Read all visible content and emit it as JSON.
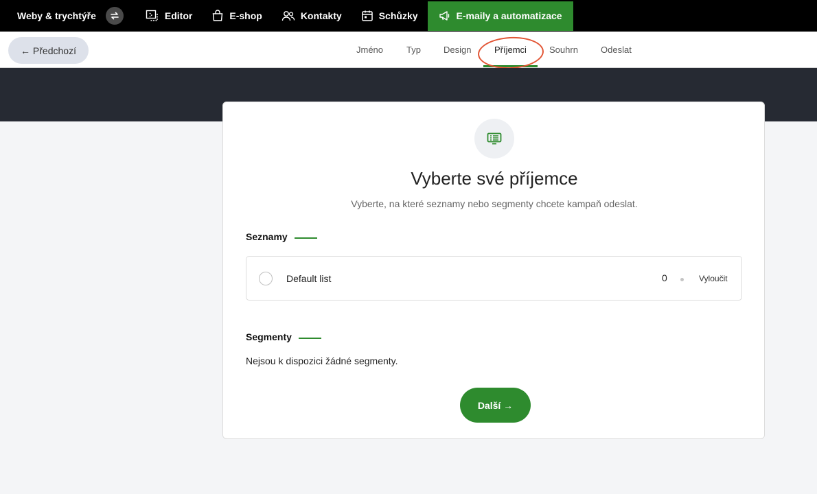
{
  "topnav": {
    "brand": "Weby & trychtýře",
    "items": [
      {
        "label": "Editor",
        "icon": "editor-icon"
      },
      {
        "label": "E-shop",
        "icon": "shopping-bag-icon"
      },
      {
        "label": "Kontakty",
        "icon": "contacts-icon"
      },
      {
        "label": "Schůzky",
        "icon": "calendar-icon"
      },
      {
        "label": "E-maily a automatizace",
        "icon": "megaphone-icon",
        "active": true
      }
    ],
    "active_color": "#2e8b2e"
  },
  "stepbar": {
    "prev_label": "← Předchozí",
    "steps": [
      "Jméno",
      "Typ",
      "Design",
      "Příjemci",
      "Souhrn",
      "Odeslat"
    ],
    "active_step": "Příjemci"
  },
  "card": {
    "title": "Vyberte své příjemce",
    "subtitle": "Vyberte, na které seznamy nebo segmenty chcete kampaň odeslat.",
    "lists_heading": "Seznamy",
    "lists": [
      {
        "name": "Default list",
        "count": "0",
        "exclude_label": "Vyloučit"
      }
    ],
    "segments_heading": "Segmenty",
    "segments_empty": "Nejsou k dispozici žádné segmenty.",
    "next_label": "Další →"
  },
  "colors": {
    "accent": "#2e8b2e",
    "header_bg": "#000000",
    "band_bg": "#262a33",
    "highlight": "#e25535"
  }
}
